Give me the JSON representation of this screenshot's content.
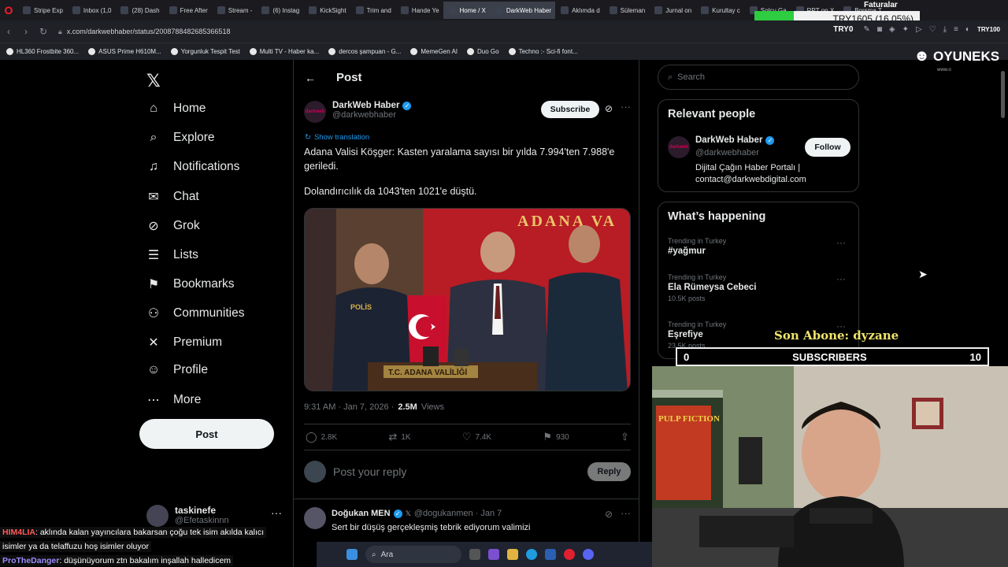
{
  "tabs": [
    {
      "label": "Stripe Exp"
    },
    {
      "label": "Inbox (1,0"
    },
    {
      "label": "(28) Dash"
    },
    {
      "label": "Free After"
    },
    {
      "label": "Stream - "
    },
    {
      "label": "(6) Instag"
    },
    {
      "label": "KickSight"
    },
    {
      "label": "Trim and"
    },
    {
      "label": "Hande Ye"
    },
    {
      "label": "Home / X"
    },
    {
      "label": "DarkWeb Haber"
    },
    {
      "label": "Aklımda d"
    },
    {
      "label": "Süleman"
    },
    {
      "label": "Jurnal on"
    },
    {
      "label": "Kurultay c"
    },
    {
      "label": "Solcu Ga"
    },
    {
      "label": "RPT on X"
    },
    {
      "label": "Borsma T"
    }
  ],
  "price_overlay": {
    "text": "TRY1605 (16.05%)",
    "top_label": "Faturalar"
  },
  "address": {
    "url": "x.com/darkwebhaber/status/2008788482685366518",
    "try_badge": "TRY0",
    "right_label": "TRY100"
  },
  "bookmarks": [
    "HL360 Frostbite 360...",
    "ASUS Prime H610M...",
    "Yorgunluk Tespit Test",
    "Multi TV - Haber ka...",
    "dercos şampuan - G...",
    "MemeGen AI",
    "Duo Go",
    "Techno :- Sci-fi font..."
  ],
  "nav": {
    "items": [
      {
        "label": "Home",
        "icon": "⌂"
      },
      {
        "label": "Explore",
        "icon": "⌕"
      },
      {
        "label": "Notifications",
        "icon": "♫"
      },
      {
        "label": "Chat",
        "icon": "✉"
      },
      {
        "label": "Grok",
        "icon": "⊘"
      },
      {
        "label": "Lists",
        "icon": "☰"
      },
      {
        "label": "Bookmarks",
        "icon": "⚑"
      },
      {
        "label": "Communities",
        "icon": "⚇"
      },
      {
        "label": "Premium",
        "icon": "✕"
      },
      {
        "label": "Profile",
        "icon": "☺"
      },
      {
        "label": "More",
        "icon": "⋯"
      }
    ],
    "post_button": "Post",
    "account": {
      "name": "taskinefe",
      "handle": "@Efetaskinnn"
    }
  },
  "post": {
    "header": "Post",
    "author_name": "DarkWeb Haber",
    "author_handle": "@darkwebhaber",
    "subscribe": "Subscribe",
    "show_translation": "Show translation",
    "text1": "Adana Valisi Köşger: Kasten yaralama sayısı bir yılda 7.994'ten 7.988'e geriledi.",
    "text2": "Dolandırıcılık da 1043'ten 1021'e düştü.",
    "image_banner": "T.C. ADANA VALİLİĞİ",
    "image_wall": "ADANA VA",
    "image_badge": "POLİS",
    "time": "9:31 AM · Jan 7, 2026 ·",
    "views": "2.5M",
    "views_label": "Views",
    "stats": {
      "replies": "2.8K",
      "reposts": "1K",
      "likes": "7.4K",
      "bookmarks": "930"
    },
    "reply_placeholder": "Post your reply",
    "reply_button": "Reply"
  },
  "comment": {
    "name": "Doğukan MEN",
    "handle": "@dogukanmen · Jan 7",
    "text": "Sert bir düşüş gerçekleşmiş tebrik ediyorum valimizi"
  },
  "sidebar": {
    "search_placeholder": "Search",
    "relevant_title": "Relevant people",
    "person": {
      "name": "DarkWeb Haber",
      "handle": "@darkwebhaber",
      "bio": "Dijital Çağın Haber Portalı | contact@darkwebdigital.com",
      "follow": "Follow"
    },
    "happening_title": "What’s happening",
    "trends": [
      {
        "sub": "Trending in Turkey",
        "title": "#yağmur",
        "posts": ""
      },
      {
        "sub": "Trending in Turkey",
        "title": "Ela Rümeysa Cebeci",
        "posts": "10.5K posts"
      },
      {
        "sub": "Trending in Turkey",
        "title": "Eşrefiye",
        "posts": "23.5K posts"
      }
    ]
  },
  "stream": {
    "brand": "OYUNEKS",
    "brand_sub": "www.o",
    "son_abone": "Son Abone: dyzane",
    "subs_left": "0",
    "subs_label": "SUBSCRIBERS",
    "subs_right": "10",
    "webcam_poster": "PULP FICTION"
  },
  "chat": [
    {
      "user": "HIM4LIA",
      "text": ": aklında kalan yayıncılara bakarsan çoğu tek isim akılda kalıcı"
    },
    {
      "user": "",
      "text": "isimler ya da telaffuzu hoş isimler oluyor"
    },
    {
      "user": "ProTheDanger",
      "text": ": düşünüyorum ztn bakalım inşallah halledicem"
    }
  ],
  "taskbar": {
    "search": "Ara"
  },
  "colors": {
    "accent": "#1d9bf0",
    "background": "#000000",
    "price_green": "#2ecc40",
    "son_abone": "#f1e46b"
  }
}
